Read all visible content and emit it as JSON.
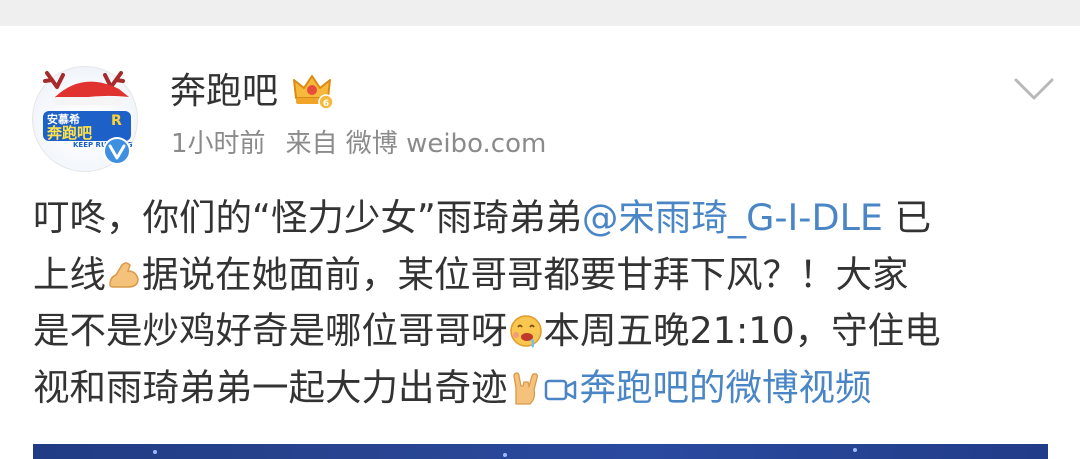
{
  "post": {
    "author": "奔跑吧",
    "timestamp": "1小时前",
    "source": "来自 微博 weibo.com",
    "lines": [
      {
        "pre": "叮咚，你们的“怪力少女”雨琦弟弟",
        "mention": "@宋雨琦_G-I-DLE",
        "post": " 已"
      },
      {
        "pre": "上线",
        "post": "据说在她面前，某位哥哥都要甘拜下风？！大家"
      },
      {
        "pre": "是不是炒鸡好奇是哪位哥哥呀",
        "post": "本周五晚21:10，守住电"
      },
      {
        "pre": "视和雨琦弟弟一起大力出奇迹",
        "video_link": "奔跑吧的微博视频"
      }
    ]
  },
  "icons": {
    "avatar": "running-man-logo-avatar",
    "badge": "crown-member-icon",
    "verified": "verified-v-icon",
    "menu": "chevron-down-icon",
    "video": "video-camera-icon",
    "emojis": [
      "flexed-biceps-emoji",
      "drooling-face-emoji",
      "rock-on-hand-emoji"
    ]
  },
  "colors": {
    "link": "#4a86c6",
    "text": "#333333",
    "meta": "#8b8b8b",
    "verified": "#3f8fe0"
  }
}
